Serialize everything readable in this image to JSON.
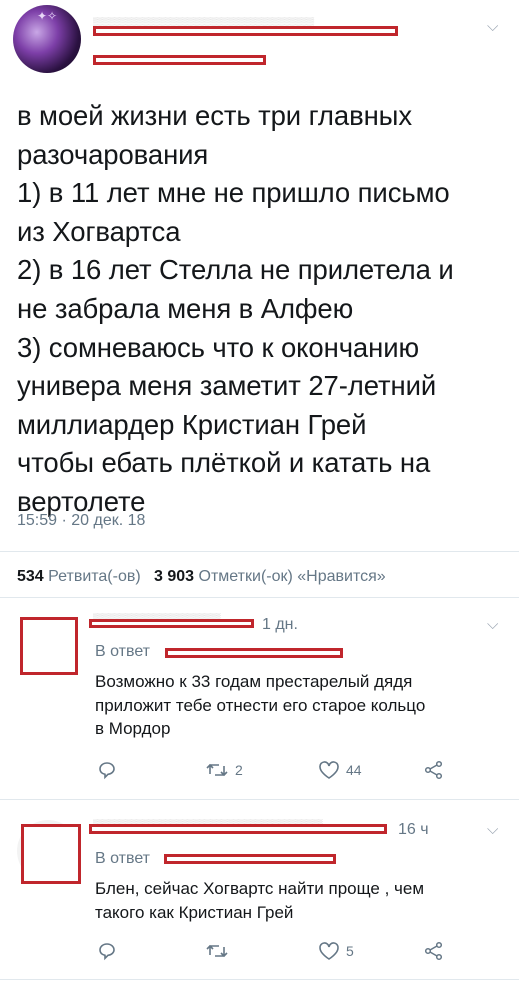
{
  "tweet": {
    "text": "в моей жизни есть три главных\nразочарования\n1) в 11 лет мне не пришло письмо\nиз Хогвартса\n2) в 16 лет Стелла не прилетела и\nне забрала меня в Алфею\n3) сомневаюсь что к окончанию\nуниверa меня заметит 27-летний\nмиллиардер Кристиан Грей\nчтобы ебать плёткой и катать на\nвертолете",
    "time": "15:59 · 20 дек. 18",
    "retweets_count": "534",
    "retweets_label": "Ретвита(-ов)",
    "likes_count": "3 903",
    "likes_label": "Отметки(-ок) «Нравится»"
  },
  "replies": [
    {
      "time": "1 дн.",
      "reply_to_label": "В ответ",
      "text": "Возможно к 33 годам престарелый дядя\nприложит тебе отнести его старое кольцо\nв Мордор",
      "retweets": "2",
      "likes": "44"
    },
    {
      "time": "16 ч",
      "reply_to_label": "В ответ",
      "text": "Блен, сейчас Хогвартс найти проще , чем\nтакого как Кристиан Грей",
      "retweets": "",
      "likes": "5"
    }
  ],
  "icons": {
    "chevron": "chevron-down-icon",
    "reply": "reply-icon",
    "retweet": "retweet-icon",
    "like": "heart-icon",
    "share": "share-icon"
  },
  "colors": {
    "redaction": "#c0262c",
    "muted": "#657786",
    "text": "#14171a",
    "divider": "#e1e8ed"
  }
}
